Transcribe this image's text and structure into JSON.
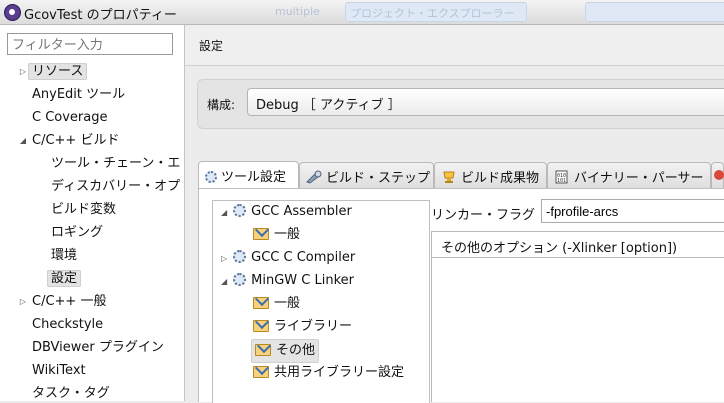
{
  "window": {
    "title": "GcovTest のプロパティー"
  },
  "background_ghost": {
    "a": "multiple",
    "b": "プロジェクト・エクスプローラー"
  },
  "left": {
    "filter_placeholder": "フィルター入力",
    "items": [
      {
        "label": "リソース",
        "twisty": "▷",
        "level": 0,
        "selected": true
      },
      {
        "label": "AnyEdit ツール",
        "twisty": "",
        "level": 0
      },
      {
        "label": "C Coverage",
        "twisty": "",
        "level": 0
      },
      {
        "label": "C/C++ ビルド",
        "twisty": "◢",
        "level": 0
      },
      {
        "label": "ツール・チェーン・エ",
        "twisty": "",
        "level": 1
      },
      {
        "label": "ディスカバリー・オプ",
        "twisty": "",
        "level": 1
      },
      {
        "label": "ビルド変数",
        "twisty": "",
        "level": 1
      },
      {
        "label": "ロギング",
        "twisty": "",
        "level": 1
      },
      {
        "label": "環境",
        "twisty": "",
        "level": 1
      },
      {
        "label": "設定",
        "twisty": "",
        "level": 1,
        "selected": true
      },
      {
        "label": "C/C++ 一般",
        "twisty": "▷",
        "level": 0
      },
      {
        "label": "Checkstyle",
        "twisty": "",
        "level": 0
      },
      {
        "label": "DBViewer プラグイン",
        "twisty": "",
        "level": 0
      },
      {
        "label": "WikiText",
        "twisty": "",
        "level": 0
      },
      {
        "label": "タスク・タグ",
        "twisty": "",
        "level": 0
      }
    ]
  },
  "right": {
    "header": "設定",
    "config_label": "構成:",
    "config_value": "Debug ［ アクティブ ］",
    "tabs": [
      {
        "label": "ツール設定",
        "icon": "gear-icon"
      },
      {
        "label": "ビルド・ステップ",
        "icon": "build-steps-icon"
      },
      {
        "label": "ビルド成果物",
        "icon": "artifact-icon"
      },
      {
        "label": "バイナリー・パーサー",
        "icon": "binary-icon"
      }
    ],
    "tool_tree": [
      {
        "label": "GCC Assembler",
        "twisty": "◢",
        "kind": "tool"
      },
      {
        "label": "一般",
        "twisty": "",
        "kind": "folder"
      },
      {
        "label": "GCC C Compiler",
        "twisty": "▷",
        "kind": "tool"
      },
      {
        "label": "MinGW C Linker",
        "twisty": "◢",
        "kind": "tool"
      },
      {
        "label": "一般",
        "twisty": "",
        "kind": "folder"
      },
      {
        "label": "ライブラリー",
        "twisty": "",
        "kind": "folder"
      },
      {
        "label": "その他",
        "twisty": "",
        "kind": "folder",
        "selected": true
      },
      {
        "label": "共用ライブラリー設定",
        "twisty": "",
        "kind": "folder"
      }
    ],
    "linker_flag_label": "リンカー・フラグ",
    "linker_flag_value": "-fprofile-arcs",
    "options_header": "その他のオプション (-Xlinker [option])"
  }
}
